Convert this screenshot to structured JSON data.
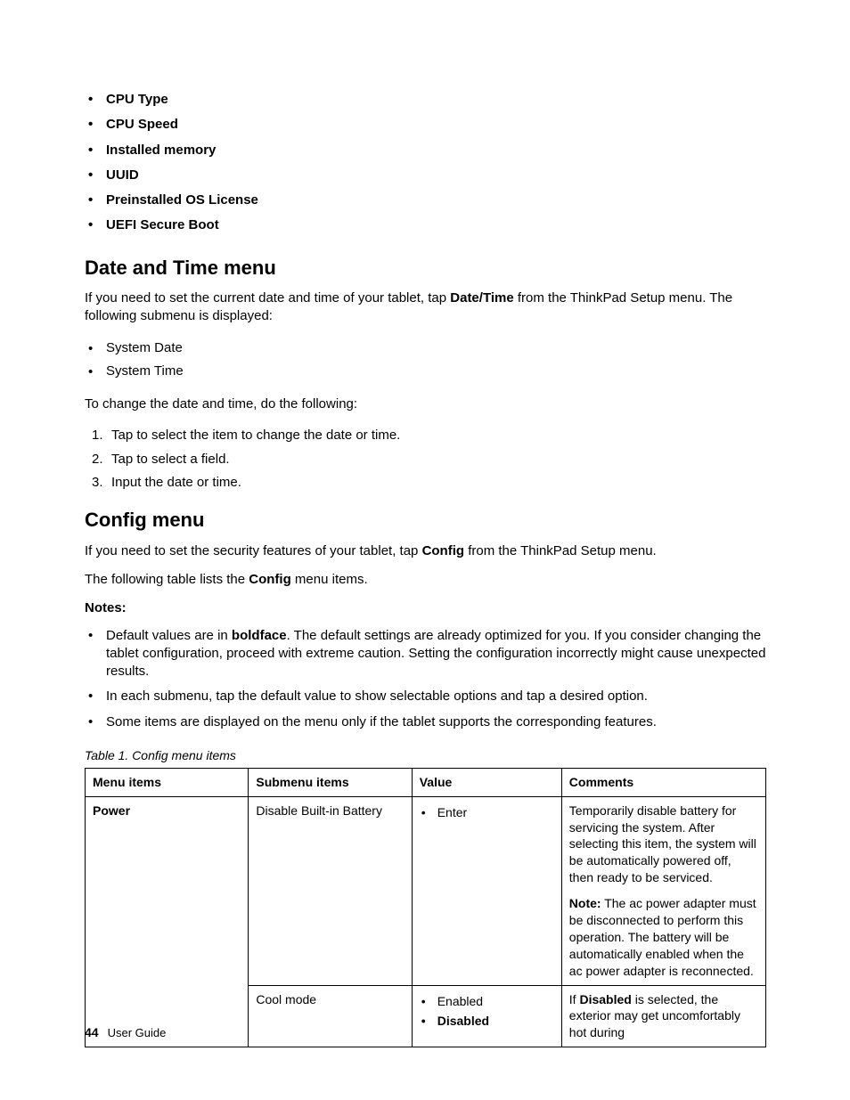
{
  "top_list": [
    "CPU Type",
    "CPU Speed",
    "Installed memory",
    "UUID",
    "Preinstalled OS License",
    "UEFI Secure Boot"
  ],
  "datetime": {
    "heading": "Date and Time menu",
    "intro_pre": "If you need to set the current date and time of your tablet, tap ",
    "intro_bold": "Date/Time",
    "intro_post": " from the ThinkPad Setup menu. The following submenu is displayed:",
    "submenu": [
      "System Date",
      "System Time"
    ],
    "change_intro": "To change the date and time, do the following:",
    "steps": [
      "Tap to select the item to change the date or time.",
      "Tap to select a field.",
      "Input the date or time."
    ]
  },
  "config": {
    "heading": "Config menu",
    "intro_pre": "If you need to set the security features of your tablet, tap ",
    "intro_bold": "Config",
    "intro_post": " from the ThinkPad Setup menu.",
    "table_sentence_pre": "The following table lists the ",
    "table_sentence_bold": "Config",
    "table_sentence_post": " menu items.",
    "notes_label": "Notes:",
    "notes": {
      "n1_pre": "Default values are in ",
      "n1_bold": "boldface",
      "n1_post": ".  The default settings are already optimized for you.  If you consider changing the tablet configuration, proceed with extreme caution.  Setting the configuration incorrectly might cause unexpected results.",
      "n2": "In each submenu, tap the default value to show selectable options and tap a desired option.",
      "n3": "Some items are displayed on the menu only if the tablet supports the corresponding features."
    },
    "table_caption": "Table 1.  Config menu items",
    "headers": {
      "menu": "Menu items",
      "submenu": "Submenu items",
      "value": "Value",
      "comments": "Comments"
    },
    "rows": {
      "r1": {
        "menu": "Power",
        "submenu": "Disable Built-in Battery",
        "value": "Enter",
        "comment_p1": "Temporarily disable battery for servicing the system. After selecting this item, the system will be automatically powered off, then ready to be serviced.",
        "comment_note_label": "Note:",
        "comment_note_text": " The ac power adapter must be disconnected to perform this operation. The battery will be automatically enabled when the ac power adapter is reconnected."
      },
      "r2": {
        "submenu": "Cool mode",
        "value1": "Enabled",
        "value2": "Disabled",
        "comment_pre": "If ",
        "comment_bold": "Disabled",
        "comment_post": " is selected, the exterior may get uncomfortably hot during"
      }
    }
  },
  "footer": {
    "page": "44",
    "title": "User Guide"
  }
}
